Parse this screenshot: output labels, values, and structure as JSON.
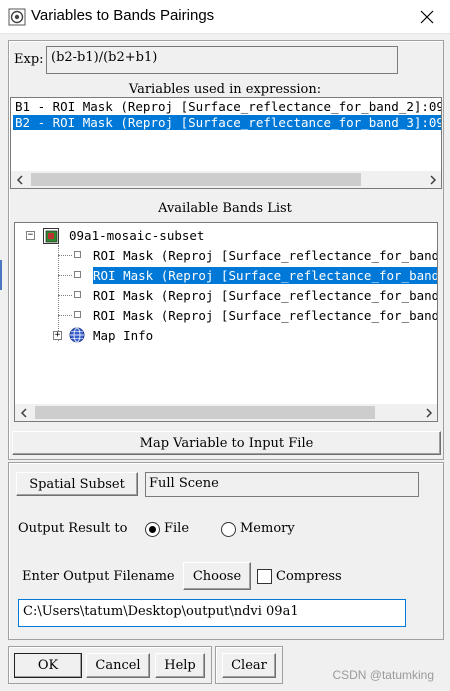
{
  "window": {
    "title": "Variables to Bands Pairings"
  },
  "expression": {
    "label": "Exp:",
    "value": "(b2-b1)/(b2+b1)"
  },
  "variables": {
    "heading": "Variables used in expression:",
    "items": [
      {
        "text": "B1 - ROI Mask (Reproj [Surface_reflectance_for_band_2]:09",
        "selected": false
      },
      {
        "text": "B2 - ROI Mask (Reproj [Surface_reflectance_for_band_3]:09",
        "selected": true
      }
    ]
  },
  "bands": {
    "heading": "Available Bands List",
    "root": "09a1-mosaic-subset",
    "items": [
      {
        "text": "ROI Mask (Reproj [Surface_reflectance_for_band",
        "selected": false
      },
      {
        "text": "ROI Mask (Reproj [Surface_reflectance_for_band",
        "selected": true
      },
      {
        "text": "ROI Mask (Reproj [Surface_reflectance_for_band",
        "selected": false
      },
      {
        "text": "ROI Mask (Reproj [Surface_reflectance_for_band",
        "selected": false
      }
    ],
    "map_info": "Map Info"
  },
  "map_variable_button": "Map Variable to Input File",
  "spatial_subset": {
    "button": "Spatial Subset",
    "value": "Full Scene"
  },
  "output": {
    "label": "Output Result to",
    "file_label": "File",
    "memory_label": "Memory",
    "selected": "File"
  },
  "filename": {
    "label": "Enter Output Filename",
    "choose_button": "Choose",
    "compress_label": "Compress",
    "compress_checked": false,
    "value": "C:\\Users\\tatum\\Desktop\\output\\ndvi 09a1"
  },
  "buttons": {
    "ok": "OK",
    "cancel": "Cancel",
    "help": "Help",
    "clear": "Clear"
  },
  "watermark": "CSDN @tatumking",
  "colors": {
    "selection": "#0078d7",
    "background": "#f0f0f0"
  }
}
